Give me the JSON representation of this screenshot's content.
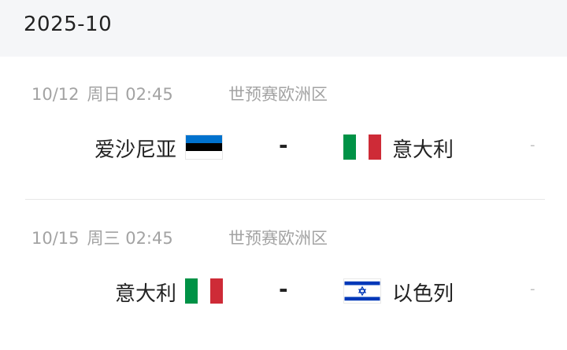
{
  "header": {
    "month": "2025-10"
  },
  "matches": [
    {
      "date": "10/12",
      "weekday_time": "周日 02:45",
      "competition": "世预赛欧洲区",
      "home": {
        "name": "爱沙尼亚",
        "flag": "estonia-flag-icon"
      },
      "vs": "-",
      "away": {
        "name": "意大利",
        "flag": "italy-flag-icon"
      },
      "score": "-"
    },
    {
      "date": "10/15",
      "weekday_time": "周三 02:45",
      "competition": "世预赛欧洲区",
      "home": {
        "name": "意大利",
        "flag": "italy-flag-icon"
      },
      "vs": "-",
      "away": {
        "name": "以色列",
        "flag": "israel-flag-icon"
      },
      "score": "-"
    }
  ],
  "colors": {
    "header_bg": "#f5f6f8",
    "meta_text": "#a3a3a3",
    "team_text": "#222222",
    "estonia_blue": "#0072ce",
    "italy_green": "#009246",
    "italy_red": "#ce2b37",
    "israel_blue": "#0038b8"
  }
}
